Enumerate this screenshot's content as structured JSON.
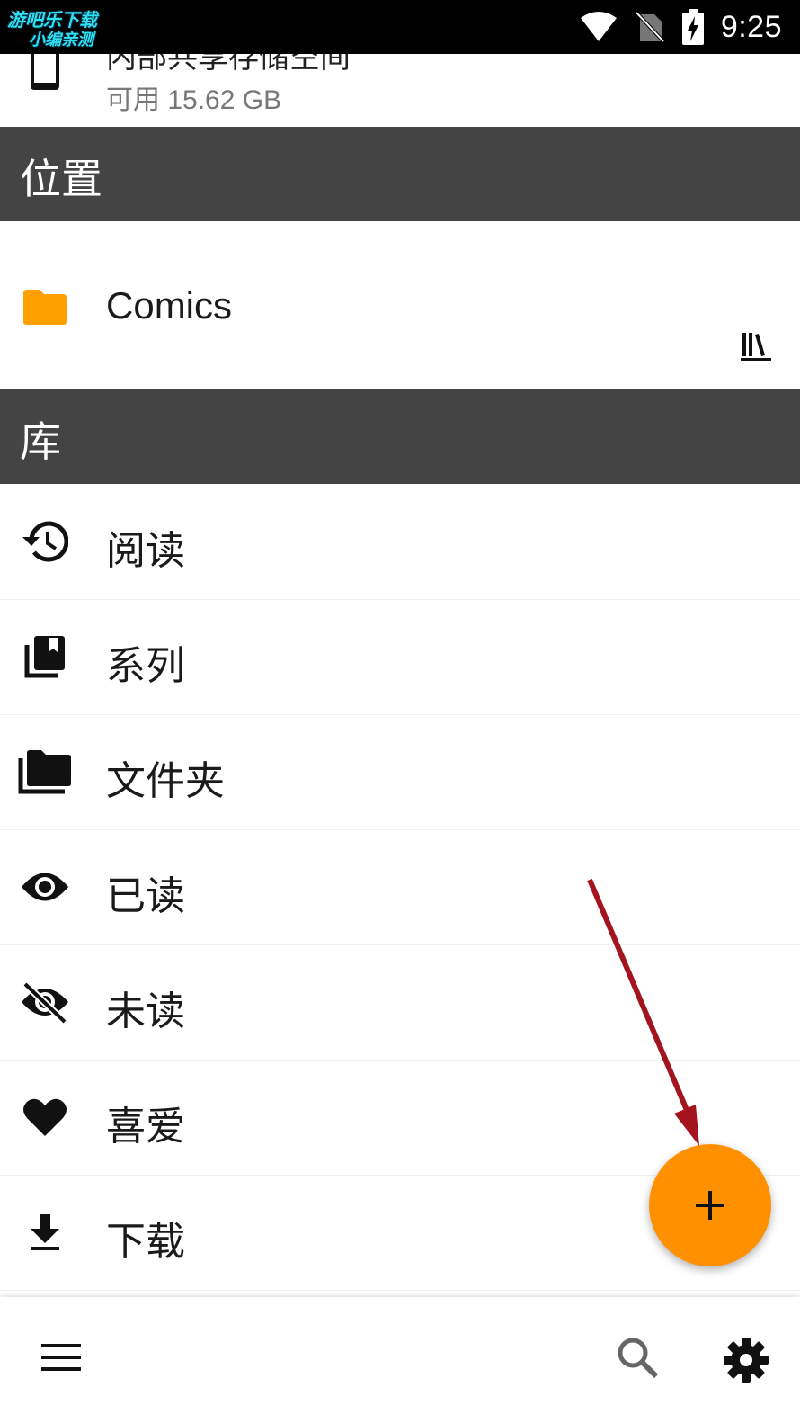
{
  "status_bar": {
    "watermark_line1": "游吧乐下载",
    "watermark_line2": "小编亲测",
    "time": "9:25",
    "icons": [
      "wifi-icon",
      "no-sim-icon",
      "battery-charging-icon"
    ]
  },
  "storage": {
    "title": "内部共享存储空间",
    "available": "可用 15.62 GB",
    "icon": "phone-icon"
  },
  "sections": {
    "locations": "位置",
    "library": "库"
  },
  "locations": [
    {
      "name": "Comics",
      "icon": "folder-icon",
      "action_icon": "library-icon"
    }
  ],
  "library": [
    {
      "label": "阅读",
      "icon": "history-icon"
    },
    {
      "label": "系列",
      "icon": "collections-icon"
    },
    {
      "label": "文件夹",
      "icon": "folders-icon"
    },
    {
      "label": "已读",
      "icon": "eye-icon"
    },
    {
      "label": "未读",
      "icon": "eye-off-icon"
    },
    {
      "label": "喜爱",
      "icon": "heart-icon"
    },
    {
      "label": "下载",
      "icon": "download-icon"
    }
  ],
  "fab": {
    "icon": "plus-icon",
    "color": "#ff9100"
  },
  "bottom_bar": {
    "icons": [
      "menu-icon",
      "search-icon",
      "settings-icon"
    ]
  },
  "colors": {
    "section_header": "#444444",
    "accent": "#ff9100",
    "folder": "#ffa000",
    "annotation_arrow": "#a3141e"
  }
}
